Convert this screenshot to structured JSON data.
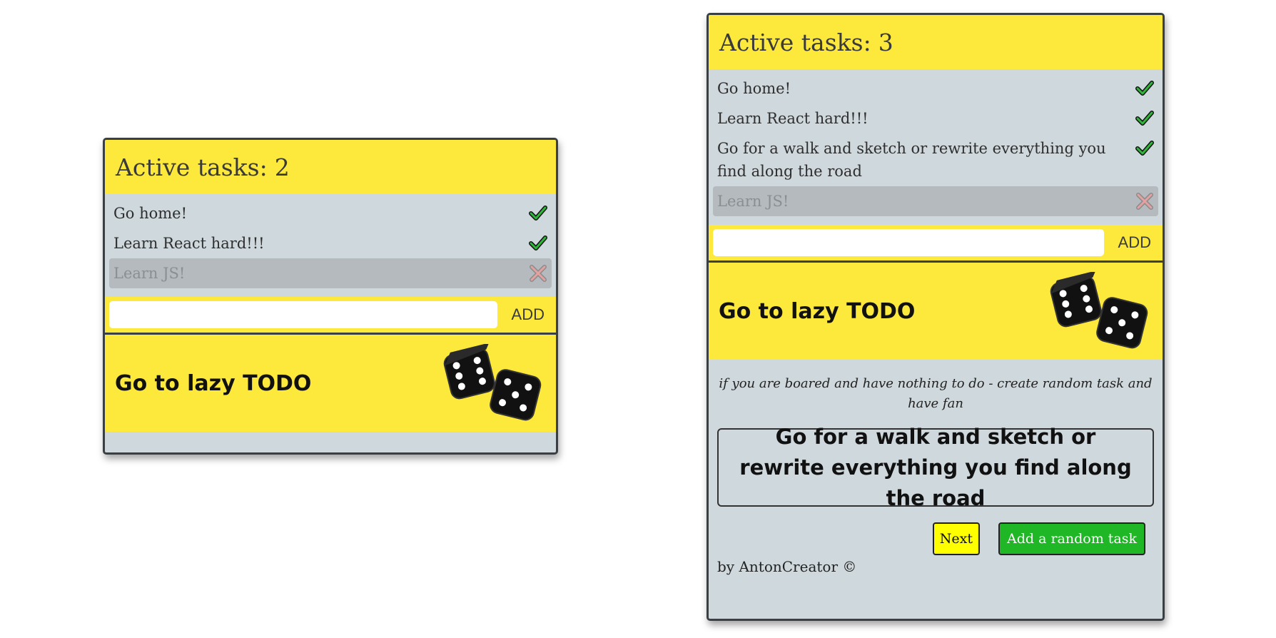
{
  "left_app": {
    "header": {
      "label": "Active tasks:",
      "count": "2"
    },
    "tasks": [
      {
        "text": "Go home!",
        "status": "check"
      },
      {
        "text": "Learn React hard!!!",
        "status": "check"
      },
      {
        "text": "Learn JS!",
        "status": "cross"
      }
    ],
    "add": {
      "value": "",
      "button": "ADD"
    },
    "lazy": {
      "label": "Go to lazy TODO",
      "icon": "dice-icon"
    }
  },
  "right_app": {
    "header": {
      "label": "Active tasks:",
      "count": "3"
    },
    "tasks": [
      {
        "text": "Go home!",
        "status": "check"
      },
      {
        "text": "Learn React hard!!!",
        "status": "check"
      },
      {
        "text": "Go for a walk and sketch or rewrite everything you find along the road",
        "status": "check"
      },
      {
        "text": "Learn JS!",
        "status": "cross"
      }
    ],
    "add": {
      "value": "",
      "button": "ADD"
    },
    "lazy": {
      "label": "Go to lazy TODO",
      "icon": "dice-icon",
      "subtitle": "if you are boared and have nothing to do - create random task and have fan",
      "random_task": "Go for a walk and sketch or rewrite everything you find along the road",
      "next_button": "Next",
      "add_random_button": "Add a random task"
    },
    "footer": "by AntonCreator ©"
  },
  "colors": {
    "yellow": "#fde93b",
    "panel_gray": "#cfd8dd",
    "check_green": "#1f9a2c",
    "cross_red": "#d98a8a",
    "add_random_green": "#1fb725",
    "next_yellow": "#ffff00"
  }
}
